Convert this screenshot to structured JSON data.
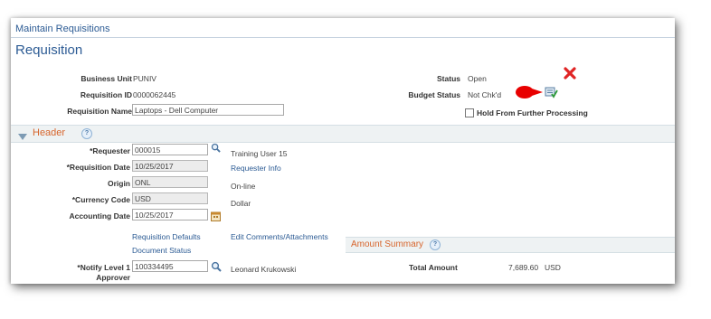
{
  "breadcrumb": "Maintain Requisitions",
  "page_title": "Requisition",
  "summary": {
    "business_unit_label": "Business Unit",
    "business_unit_value": "PUNIV",
    "requisition_id_label": "Requisition ID",
    "requisition_id_value": "0000062445",
    "requisition_name_label": "Requisition Name",
    "requisition_name_value": "Laptops - Dell Computer",
    "status_label": "Status",
    "status_value": "Open",
    "budget_status_label": "Budget Status",
    "budget_status_value": "Not Chk'd",
    "hold_label": "Hold From Further Processing",
    "hold_checked": false
  },
  "header_section": {
    "title": "Header",
    "help_glyph": "?",
    "requester_label": "*Requester",
    "requester_value": "000015",
    "requester_name": "Training User 15",
    "requester_info_link": "Requester Info",
    "requisition_date_label": "*Requisition Date",
    "requisition_date_value": "10/25/2017",
    "origin_label": "Origin",
    "origin_value": "ONL",
    "origin_desc": "On-line",
    "currency_label": "*Currency Code",
    "currency_value": "USD",
    "currency_desc": "Dollar",
    "accounting_date_label": "Accounting Date",
    "accounting_date_value": "10/25/2017",
    "requisition_defaults_link": "Requisition Defaults",
    "document_status_link": "Document Status",
    "edit_comments_link": "Edit Comments/Attachments",
    "notify_label_line1": "*Notify Level 1",
    "notify_label_line2": "Approver",
    "notify_value": "100334495",
    "notify_name": "Leonard Krukowski"
  },
  "amount_summary": {
    "title": "Amount Summary",
    "help_glyph": "?",
    "total_label": "Total Amount",
    "total_value": "7,689.60",
    "total_currency": "USD"
  },
  "colors": {
    "link": "#2c5b94",
    "section_title": "#d7642b",
    "cancel_x": "#e02424",
    "callout": "#e80000"
  },
  "icons": {
    "cancel": "close-x-icon",
    "budget_check": "budget-check-icon",
    "lookup": "magnifier-icon",
    "calendar": "calendar-icon",
    "callout": "red-callout-marker"
  }
}
